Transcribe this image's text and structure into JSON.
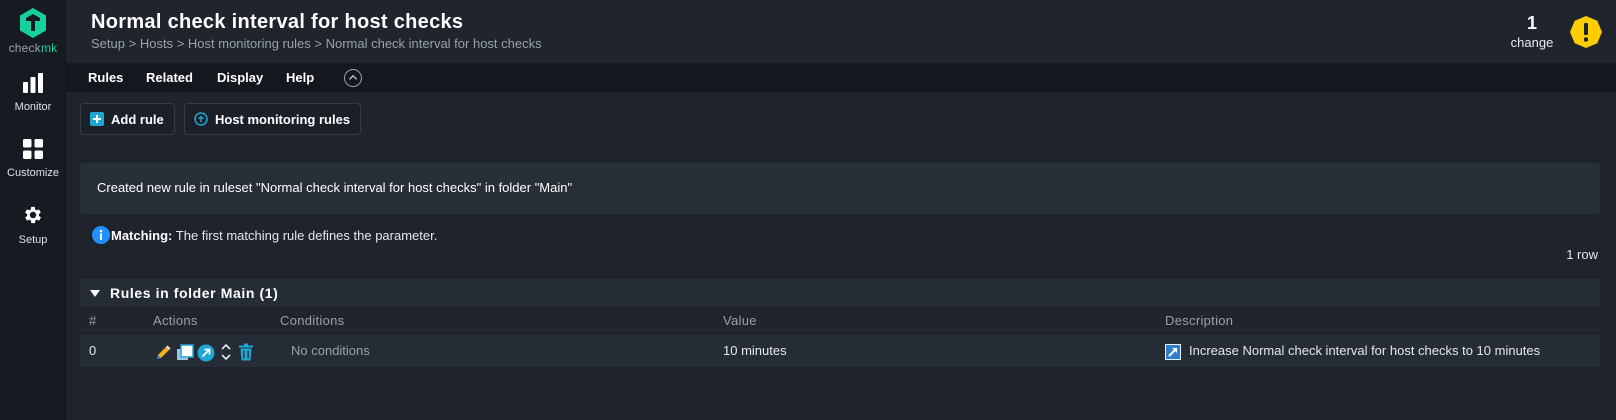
{
  "sidebar": {
    "logo": {
      "word_a": "check",
      "word_b": "mk"
    },
    "items": [
      {
        "label": "Monitor",
        "icon": "bar-chart-icon"
      },
      {
        "label": "Customize",
        "icon": "grid-icon"
      },
      {
        "label": "Setup",
        "icon": "gear-icon"
      }
    ]
  },
  "header": {
    "title": "Normal check interval for host checks",
    "breadcrumb": [
      "Setup",
      "Hosts",
      "Host monitoring rules",
      "Normal check interval for host checks"
    ],
    "breadcrumb_separator": ">",
    "changes": {
      "count": "1",
      "label": "change"
    }
  },
  "menubar": {
    "items": [
      "Rules",
      "Related",
      "Display",
      "Help"
    ]
  },
  "buttons": {
    "add_rule": "Add rule",
    "host_monitoring_rules": "Host monitoring rules"
  },
  "message": "Created new rule in ruleset \"Normal check interval for host checks\" in folder \"Main\"",
  "matching": {
    "label": "Matching:",
    "text": " The first matching rule defines the parameter."
  },
  "row_count": "1 row",
  "table": {
    "folder_title": "Rules in folder Main (1)",
    "columns": [
      "#",
      "Actions",
      "Conditions",
      "Value",
      "Description"
    ],
    "rows": [
      {
        "index": "0",
        "conditions": "No conditions",
        "value": "10 minutes",
        "description": "Increase Normal check interval for host checks to 10 minutes"
      }
    ]
  },
  "colors": {
    "accent": "#15d1a0",
    "warning": "#ffcc00",
    "info_blue": "#1e90ff",
    "background": "#1e232c"
  }
}
